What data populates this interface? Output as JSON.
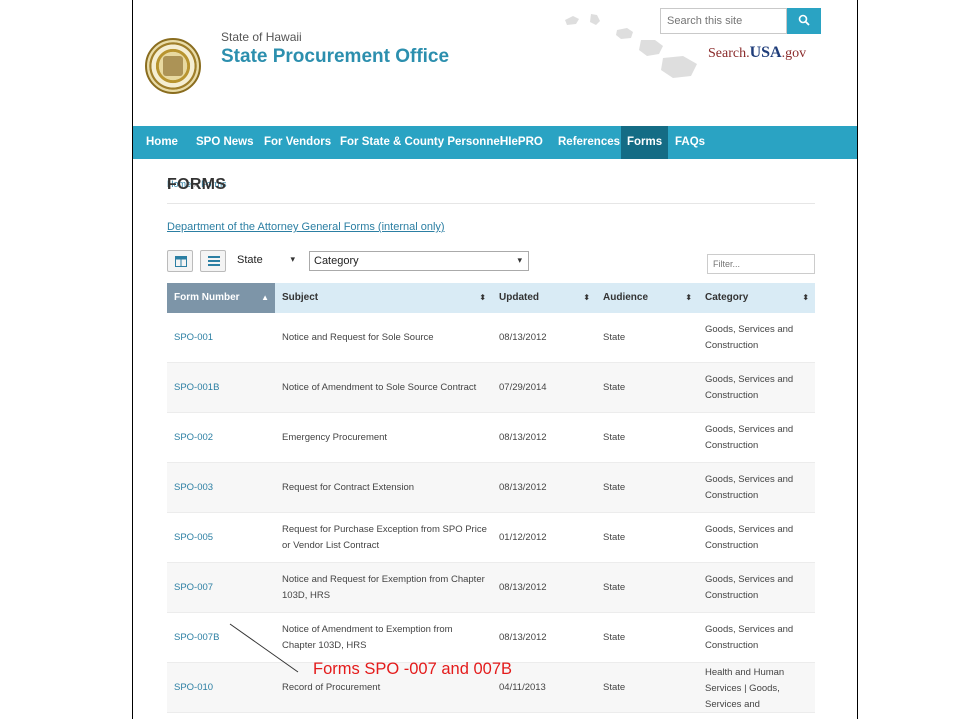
{
  "header": {
    "state_name": "State of Hawaii",
    "office_name": "State Procurement Office",
    "search_placeholder": "Search this site",
    "usa_logo_left": "Search.",
    "usa_logo_mid": "USA",
    "usa_logo_right": ".gov"
  },
  "nav": {
    "items": [
      {
        "label": "Home"
      },
      {
        "label": "SPO News"
      },
      {
        "label": "For Vendors"
      },
      {
        "label": "For State & County Personnel"
      },
      {
        "label": "HIePRO"
      },
      {
        "label": "References"
      },
      {
        "label": "Forms",
        "active": true
      },
      {
        "label": "FAQs"
      }
    ]
  },
  "breadcrumb": {
    "home": "Home",
    "separator": "»",
    "current": "Forms"
  },
  "page_title": "FORMS",
  "ag_link": "Department of the Attorney General Forms (internal only)",
  "toolbar": {
    "audience_select": "State",
    "category_select": "Category",
    "filter_placeholder": "Filter..."
  },
  "table": {
    "headers": [
      "Form Number",
      "Subject",
      "Updated",
      "Audience",
      "Category"
    ],
    "rows": [
      {
        "number": "SPO-001",
        "subject": [
          "Notice and Request for Sole Source"
        ],
        "updated": "08/13/2012",
        "audience": "State",
        "category": [
          "Goods, Services and",
          "Construction"
        ]
      },
      {
        "number": "SPO-001B",
        "subject": [
          "Notice of Amendment to Sole Source Contract"
        ],
        "updated": "07/29/2014",
        "audience": "State",
        "category": [
          "Goods, Services and",
          "Construction"
        ]
      },
      {
        "number": "SPO-002",
        "subject": [
          "Emergency Procurement"
        ],
        "updated": "08/13/2012",
        "audience": "State",
        "category": [
          "Goods, Services and",
          "Construction"
        ]
      },
      {
        "number": "SPO-003",
        "subject": [
          "Request for Contract Extension"
        ],
        "updated": "08/13/2012",
        "audience": "State",
        "category": [
          "Goods, Services and",
          "Construction"
        ]
      },
      {
        "number": "SPO-005",
        "subject": [
          "Request for Purchase Exception from SPO Price",
          "or Vendor List Contract"
        ],
        "updated": "01/12/2012",
        "audience": "State",
        "category": [
          "Goods, Services and",
          "Construction"
        ]
      },
      {
        "number": "SPO-007",
        "subject": [
          "Notice and Request for Exemption from Chapter",
          "103D, HRS"
        ],
        "updated": "08/13/2012",
        "audience": "State",
        "category": [
          "Goods, Services and",
          "Construction"
        ]
      },
      {
        "number": "SPO-007B",
        "subject": [
          "Notice of Amendment to Exemption from",
          "Chapter 103D, HRS"
        ],
        "updated": "08/13/2012",
        "audience": "State",
        "category": [
          "Goods, Services and",
          "Construction"
        ]
      },
      {
        "number": "SPO-010",
        "subject": [
          "Record of Procurement"
        ],
        "updated": "04/11/2013",
        "audience": "State",
        "category": [
          "Health and Human",
          "Services | Goods,",
          "Services and"
        ]
      }
    ]
  },
  "annotation": {
    "text": "Forms SPO -007 and 007B",
    "color": "#e41b1b"
  },
  "colors": {
    "nav": "#2aa3c3",
    "nav_active": "#146c85",
    "link": "#2c7fa3",
    "title": "#2c8fae",
    "header_row": "#d9ebf5",
    "sorted_header": "#7d95a8"
  }
}
